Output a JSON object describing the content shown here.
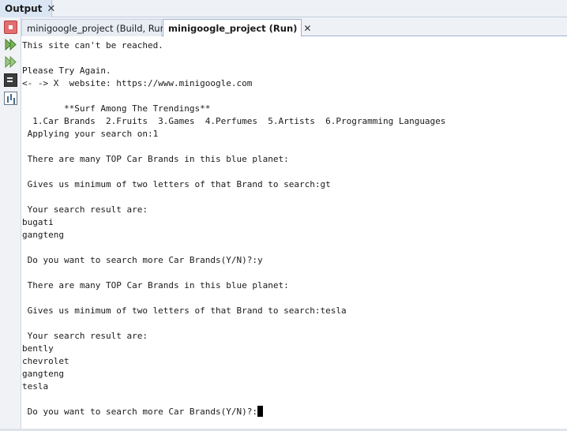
{
  "panel": {
    "title": "Output"
  },
  "tabs": [
    {
      "label": "minigoogle_project (Build, Run)"
    },
    {
      "label": "minigoogle_project (Run)"
    }
  ],
  "sidebar_icons": [
    "stop-icon",
    "rerun-icon",
    "rerun-with-options-icon",
    "terminal-icon",
    "statistics-icon"
  ],
  "console": {
    "lines": [
      "This site can't be reached.",
      "",
      "Please Try Again.",
      "<- -> X  website: https://www.minigoogle.com",
      "",
      "        **Surf Among The Trendings**",
      "  1.Car Brands  2.Fruits  3.Games  4.Perfumes  5.Artists  6.Programming Languages",
      " Applying your search on:1",
      "",
      " There are many TOP Car Brands in this blue planet:",
      "",
      " Gives us minimum of two letters of that Brand to search:gt",
      "",
      " Your search result are:",
      "bugati",
      "gangteng",
      "",
      " Do you want to search more Car Brands(Y/N)?:y",
      "",
      " There are many TOP Car Brands in this blue planet:",
      "",
      " Gives us minimum of two letters of that Brand to search:tesla",
      "",
      " Your search result are:",
      "bently",
      "chevrolet",
      "gangteng",
      "tesla",
      "",
      " Do you want to search more Car Brands(Y/N)?:"
    ]
  }
}
